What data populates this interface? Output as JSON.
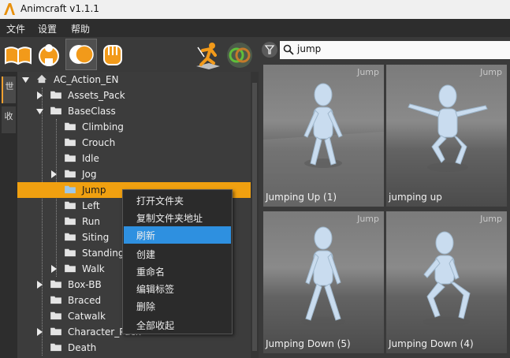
{
  "window": {
    "title": "Animcraft v1.1.1"
  },
  "menu": [
    "文件",
    "设置",
    "帮助"
  ],
  "toolbar": {
    "left_buttons": [
      "book-icon",
      "character-armor-icon",
      "circles-toggle-icon",
      "fist-icon"
    ],
    "active_index": 2,
    "right_buttons": [
      "running-figure-icon",
      "green-circles-icon"
    ]
  },
  "search": {
    "value": "jump"
  },
  "side_tabs": [
    "世",
    "收"
  ],
  "tree": {
    "rows": [
      {
        "label": "AC_Action_EN",
        "depth": 0,
        "arrow": "down",
        "icon": "home"
      },
      {
        "label": "Assets_Pack",
        "depth": 1,
        "arrow": "right",
        "icon": "folder"
      },
      {
        "label": "BaseClass",
        "depth": 1,
        "arrow": "down",
        "icon": "folder"
      },
      {
        "label": "Climbing",
        "depth": 2,
        "arrow": "",
        "icon": "folder"
      },
      {
        "label": "Crouch",
        "depth": 2,
        "arrow": "",
        "icon": "folder"
      },
      {
        "label": "Idle",
        "depth": 2,
        "arrow": "",
        "icon": "folder"
      },
      {
        "label": "Jog",
        "depth": 2,
        "arrow": "right",
        "icon": "folder"
      },
      {
        "label": "Jump",
        "depth": 2,
        "arrow": "",
        "icon": "folder-open",
        "selected": true
      },
      {
        "label": "Left",
        "depth": 2,
        "arrow": "",
        "icon": "folder"
      },
      {
        "label": "Run",
        "depth": 2,
        "arrow": "",
        "icon": "folder"
      },
      {
        "label": "Siting",
        "depth": 2,
        "arrow": "",
        "icon": "folder"
      },
      {
        "label": "Standing",
        "depth": 2,
        "arrow": "",
        "icon": "folder"
      },
      {
        "label": "Walk",
        "depth": 2,
        "arrow": "right",
        "icon": "folder"
      },
      {
        "label": "Box-BB",
        "depth": 1,
        "arrow": "right",
        "icon": "folder"
      },
      {
        "label": "Braced",
        "depth": 1,
        "arrow": "",
        "icon": "folder"
      },
      {
        "label": "Catwalk",
        "depth": 1,
        "arrow": "",
        "icon": "folder"
      },
      {
        "label": "Character_Pack",
        "depth": 1,
        "arrow": "right",
        "icon": "folder"
      },
      {
        "label": "Death",
        "depth": 1,
        "arrow": "",
        "icon": "folder"
      }
    ]
  },
  "context_menu": {
    "items": [
      "打开文件夹",
      "复制文件夹地址",
      "刷新",
      "创建",
      "重命名",
      "编辑标签",
      "删除",
      "全部收起"
    ],
    "highlighted": "刷新"
  },
  "assets": [
    {
      "name": "Jumping Up (1)",
      "tag": "Jump",
      "pose": "stand"
    },
    {
      "name": "jumping up",
      "tag": "Jump",
      "pose": "crouch-arms-out"
    },
    {
      "name": "Jumping Down (5)",
      "tag": "Jump",
      "pose": "stand-wide"
    },
    {
      "name": "Jumping Down (4)",
      "tag": "Jump",
      "pose": "land"
    }
  ],
  "colors": {
    "accent": "#f0a010",
    "highlight": "#2e90e0",
    "figure": "#c9dcef"
  }
}
